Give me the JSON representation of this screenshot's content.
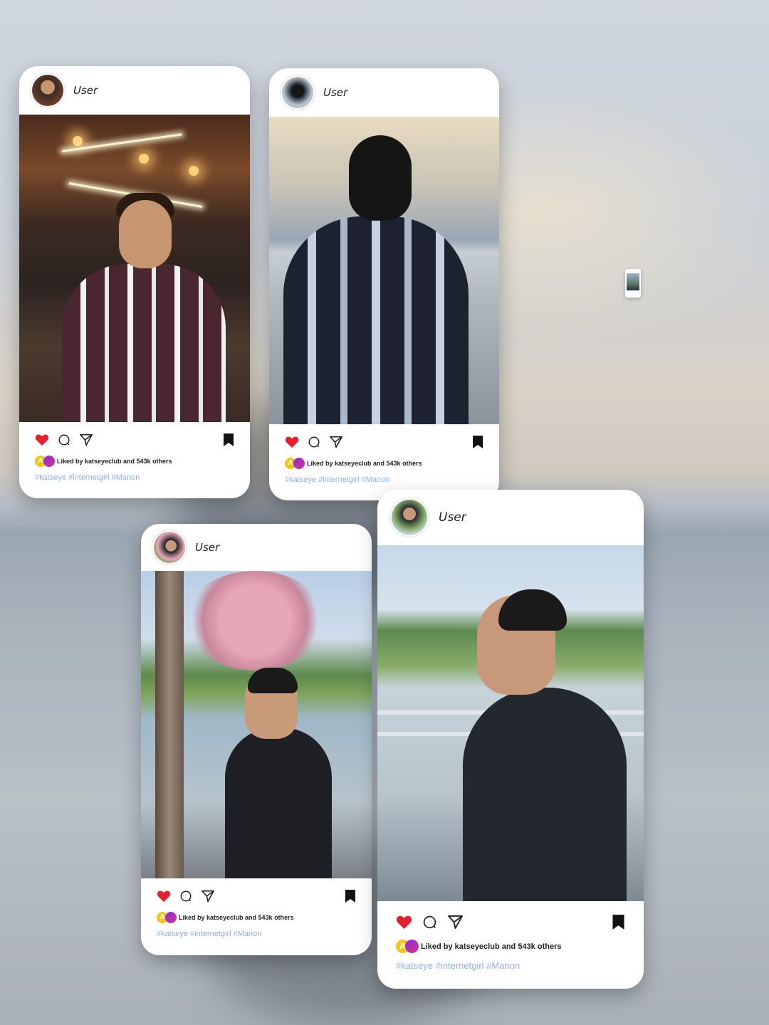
{
  "background": {
    "tone": "blurred seaside dusk",
    "accent": "#ffffff"
  },
  "posts": [
    {
      "username": "User",
      "liked_badge": "A",
      "liked_text": "Liked by katseyeclub and 543k others",
      "hashtags": "#katseye #internetgirl #Manon"
    },
    {
      "username": "User",
      "liked_badge": "A",
      "liked_text": "Liked by katseyeclub and 543k others",
      "hashtags": "#katseye #internetgirl #Manon"
    },
    {
      "username": "User",
      "liked_badge": "A",
      "liked_text": "Liked by katseyeclub and 543k others",
      "hashtags": "#katseye #internetgirl #Manon"
    },
    {
      "username": "User",
      "liked_badge": "A",
      "liked_text": "Liked by katseyeclub and 543k others",
      "hashtags": "#katseye #internetgirl #Manon"
    }
  ],
  "colors": {
    "heart": "#e5202f",
    "hashtag": "#8fb0e8",
    "badge_yellow": "#f5c518",
    "badge_purple": "#8a2be2"
  },
  "icons": [
    "heart-icon",
    "comment-icon",
    "share-icon",
    "bookmark-icon"
  ]
}
